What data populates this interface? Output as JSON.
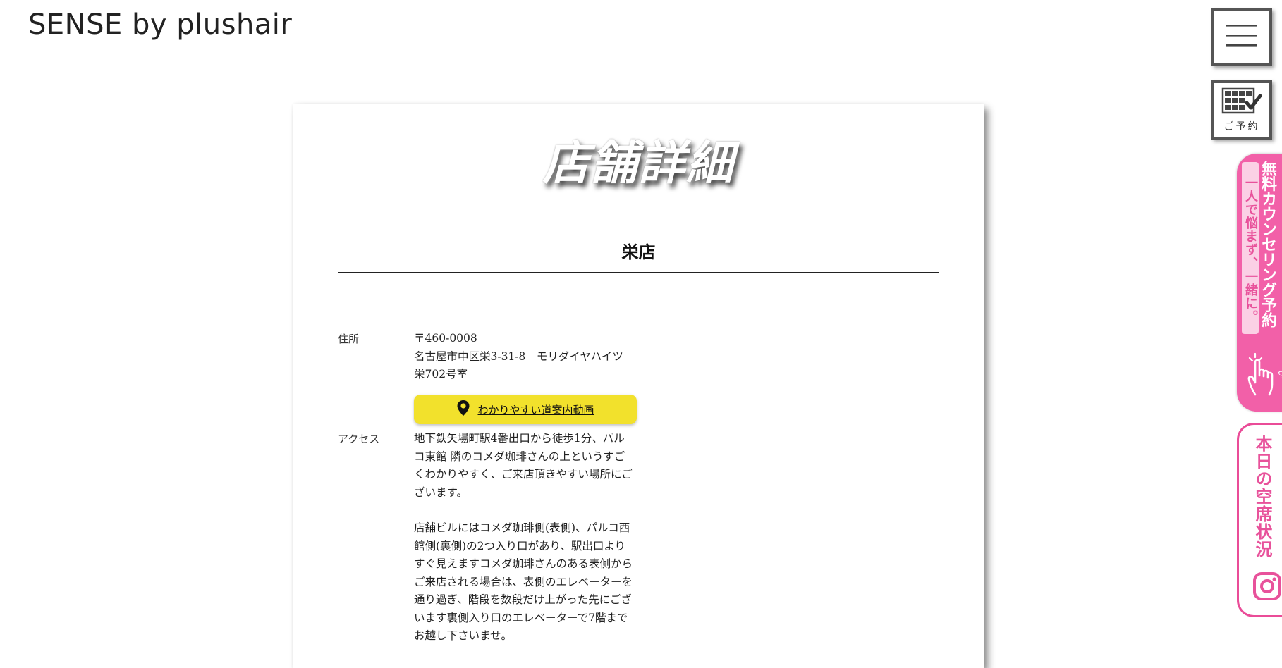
{
  "header": {
    "logo": "SENSE by plushair"
  },
  "main": {
    "title": "店舗詳細",
    "shop_name": "栄店",
    "address": {
      "label": "住所",
      "lines": [
        "〒460-0008",
        "名古屋市中区栄3-31-8　モリダイヤハイツ栄702号室"
      ]
    },
    "map_button": {
      "label": "わかりやすい道案内動画",
      "icon": "map-pin-icon"
    },
    "access": {
      "label": "アクセス",
      "paragraphs": [
        "地下鉄矢場町駅4番出口から徒歩1分、パルコ東館 隣のコメダ珈琲さんの上というすごくわかりやすく、ご来店頂きやすい場所にございます。",
        "店舗ビルにはコメダ珈琲側(表側)、パルコ西館側(裏側)の2つ入り口があり、駅出口よりすぐ見えますコメダ珈琲さんのある表側からご来店される場合は、表側のエレベーターを通り過ぎ、階段を数段だけ上がった先にございます裏側入り口のエレベーターで7階までお越し下さいませ。"
      ]
    }
  },
  "side": {
    "menu_icon": "hamburger-menu-icon",
    "reserve": {
      "label": "ご予約",
      "icon": "calendar-check-icon"
    },
    "counseling": {
      "main": "無料カウンセリング予約",
      "sub": "一人で悩まず、一緒に。",
      "click": "click!",
      "icon": "hand-pointer-icon"
    },
    "seats": {
      "label": "本日の空席状況",
      "icon": "instagram-icon"
    }
  },
  "colors": {
    "accent_yellow": "#f2e12c",
    "accent_pink": "#f260a8",
    "pink_border": "#ea4c98"
  }
}
